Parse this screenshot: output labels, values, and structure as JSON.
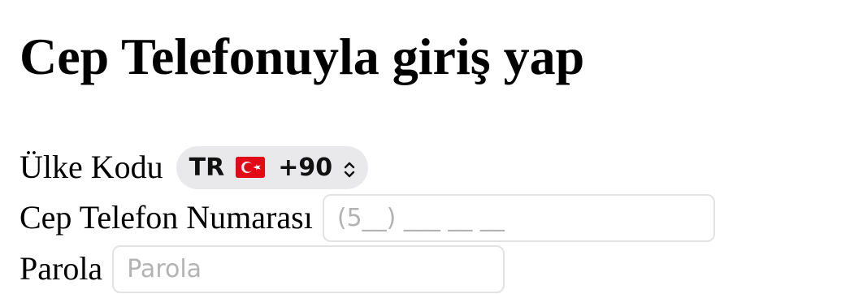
{
  "page": {
    "title": "Cep Telefonuyla giriş yap"
  },
  "form": {
    "country_label": "Ülke Kodu",
    "country_select": {
      "code": "TR",
      "flag_icon": "turkey-flag-icon",
      "dial_code": "+90",
      "chevron_icon": "updown-chevron-icon"
    },
    "phone_label": "Cep Telefon Numarası",
    "phone_placeholder": "(5__) ___ __ __",
    "phone_value": "",
    "password_label": "Parola",
    "password_placeholder": "Parola",
    "password_value": ""
  },
  "colors": {
    "select_background": "#e9e9eb",
    "input_border": "#e3e3e3",
    "placeholder_text": "#b3b3b3",
    "flag_red": "#e30a17"
  }
}
